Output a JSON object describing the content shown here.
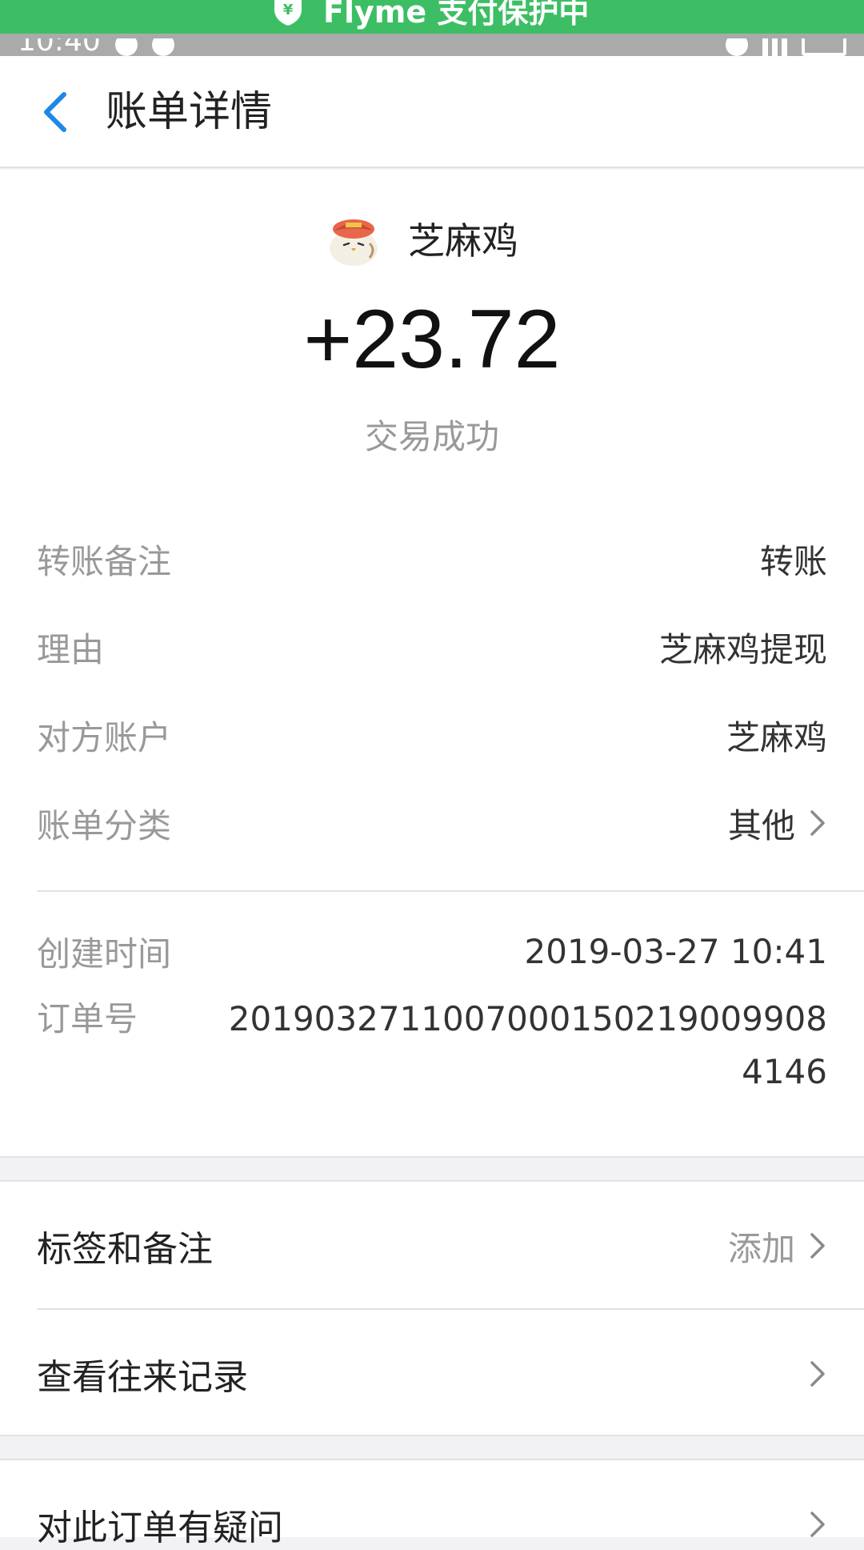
{
  "status_bar": {
    "time": "10:40"
  },
  "pay_banner": {
    "text": "Flyme 支付保护中",
    "icon": "shield-yen-icon",
    "color": "#3dbe65"
  },
  "nav": {
    "title": "账单详情",
    "back_icon": "chevron-left-icon",
    "accent": "#1e88e5"
  },
  "header": {
    "merchant_name": "芝麻鸡",
    "amount": "+23.72",
    "status": "交易成功"
  },
  "details": [
    {
      "label": "转账备注",
      "value": "转账"
    },
    {
      "label": "理由",
      "value": "芝麻鸡提现"
    },
    {
      "label": "对方账户",
      "value": "芝麻鸡"
    },
    {
      "label": "账单分类",
      "value": "其他"
    }
  ],
  "meta": [
    {
      "label": "创建时间",
      "value": "2019-03-27 10:41"
    },
    {
      "label": "订单号",
      "value": "2019032711007000150219009908414 6"
    }
  ],
  "order_number": "20190327110070001502190099084146",
  "actions": [
    {
      "label": "标签和备注",
      "hint": "添加"
    },
    {
      "label": "查看往来记录",
      "hint": ""
    }
  ],
  "help": {
    "label": "对此订单有疑问"
  }
}
